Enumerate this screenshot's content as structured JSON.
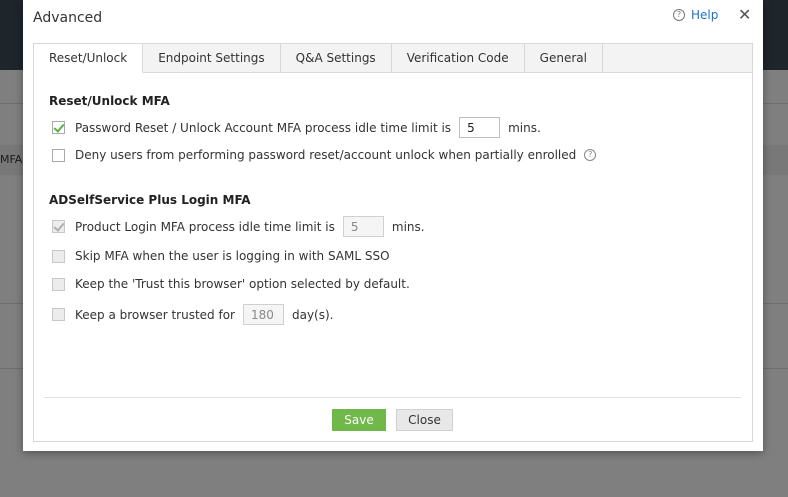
{
  "background": {
    "partial_column_label": "MFA"
  },
  "dialog": {
    "title": "Advanced",
    "help_label": "Help",
    "close_symbol": "✕",
    "tabs": [
      {
        "label": "Reset/Unlock",
        "active": true
      },
      {
        "label": "Endpoint Settings",
        "active": false
      },
      {
        "label": "Q&A Settings",
        "active": false
      },
      {
        "label": "Verification Code",
        "active": false
      },
      {
        "label": "General",
        "active": false
      }
    ],
    "reset_unlock": {
      "title": "Reset/Unlock MFA",
      "idle_limit": {
        "checked": true,
        "label": "Password Reset / Unlock Account MFA process idle time limit is",
        "value": "5",
        "suffix": "mins."
      },
      "deny_partial": {
        "checked": false,
        "label": "Deny users from performing password reset/account unlock when partially enrolled"
      }
    },
    "login_mfa": {
      "title": "ADSelfService Plus Login MFA",
      "product_idle": {
        "checked": true,
        "disabled": true,
        "label": "Product Login MFA process idle time limit is",
        "value": "5",
        "suffix": "mins."
      },
      "skip_saml": {
        "checked": false,
        "disabled": true,
        "label": "Skip MFA when the user is logging in with SAML SSO"
      },
      "trust_browser": {
        "checked": false,
        "disabled": true,
        "label": "Keep the 'Trust this browser' option selected by default."
      },
      "trusted_days": {
        "checked": false,
        "disabled": true,
        "label": "Keep a browser trusted for",
        "value": "180",
        "suffix": "day(s)."
      }
    },
    "buttons": {
      "save": "Save",
      "close": "Close"
    },
    "colors": {
      "accent_green": "#70b84a",
      "link_blue": "#1a73c8"
    }
  }
}
